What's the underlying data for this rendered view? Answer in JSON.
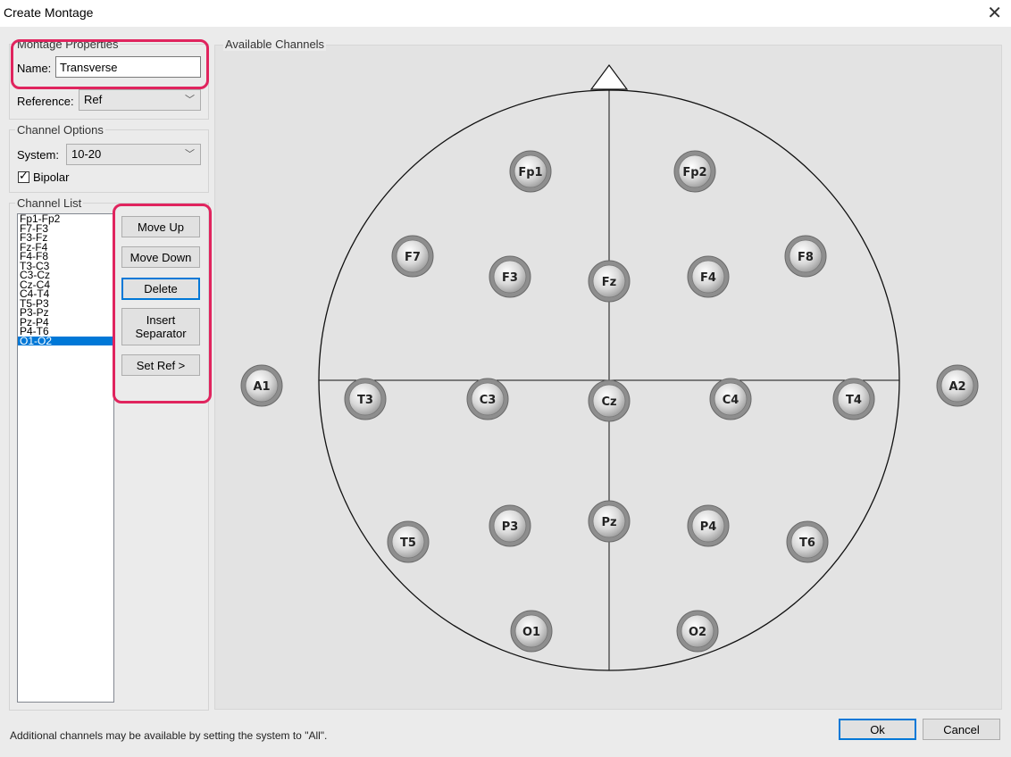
{
  "window": {
    "title": "Create Montage",
    "close_glyph": "✕"
  },
  "montage_properties": {
    "legend": "Montage Properties",
    "name_label": "Name:",
    "name_value": "Transverse",
    "reference_label": "Reference:",
    "reference_value": "Ref"
  },
  "channel_options": {
    "legend": "Channel Options",
    "system_label": "System:",
    "system_value": "10-20",
    "bipolar_label": "Bipolar",
    "bipolar_checked": true
  },
  "channel_list": {
    "legend": "Channel List",
    "items": [
      "Fp1-Fp2",
      "F7-F3",
      "F3-Fz",
      "Fz-F4",
      "F4-F8",
      "T3-C3",
      "C3-Cz",
      "Cz-C4",
      "C4-T4",
      "T5-P3",
      "P3-Pz",
      "Pz-P4",
      "P4-T6",
      "O1-O2"
    ],
    "selected": "O1-O2"
  },
  "buttons": {
    "move_up": "Move Up",
    "move_down": "Move Down",
    "delete": "Delete",
    "insert_separator": "Insert\nSeparator",
    "set_ref": "Set Ref >",
    "ok": "Ok",
    "cancel": "Cancel"
  },
  "available_channels": {
    "legend": "Available Channels",
    "electrodes": [
      {
        "label": "Fp1"
      },
      {
        "label": "Fp2"
      },
      {
        "label": "F7"
      },
      {
        "label": "F3"
      },
      {
        "label": "Fz"
      },
      {
        "label": "F4"
      },
      {
        "label": "F8"
      },
      {
        "label": "A1"
      },
      {
        "label": "T3"
      },
      {
        "label": "C3"
      },
      {
        "label": "Cz"
      },
      {
        "label": "C4"
      },
      {
        "label": "T4"
      },
      {
        "label": "A2"
      },
      {
        "label": "T5"
      },
      {
        "label": "P3"
      },
      {
        "label": "Pz"
      },
      {
        "label": "P4"
      },
      {
        "label": "T6"
      },
      {
        "label": "O1"
      },
      {
        "label": "O2"
      }
    ]
  },
  "status_text": "Additional channels may be available by setting the system to \"All\".",
  "colors": {
    "highlight": "#e0245e",
    "selection": "#0078d7",
    "focus": "#0078d7"
  }
}
